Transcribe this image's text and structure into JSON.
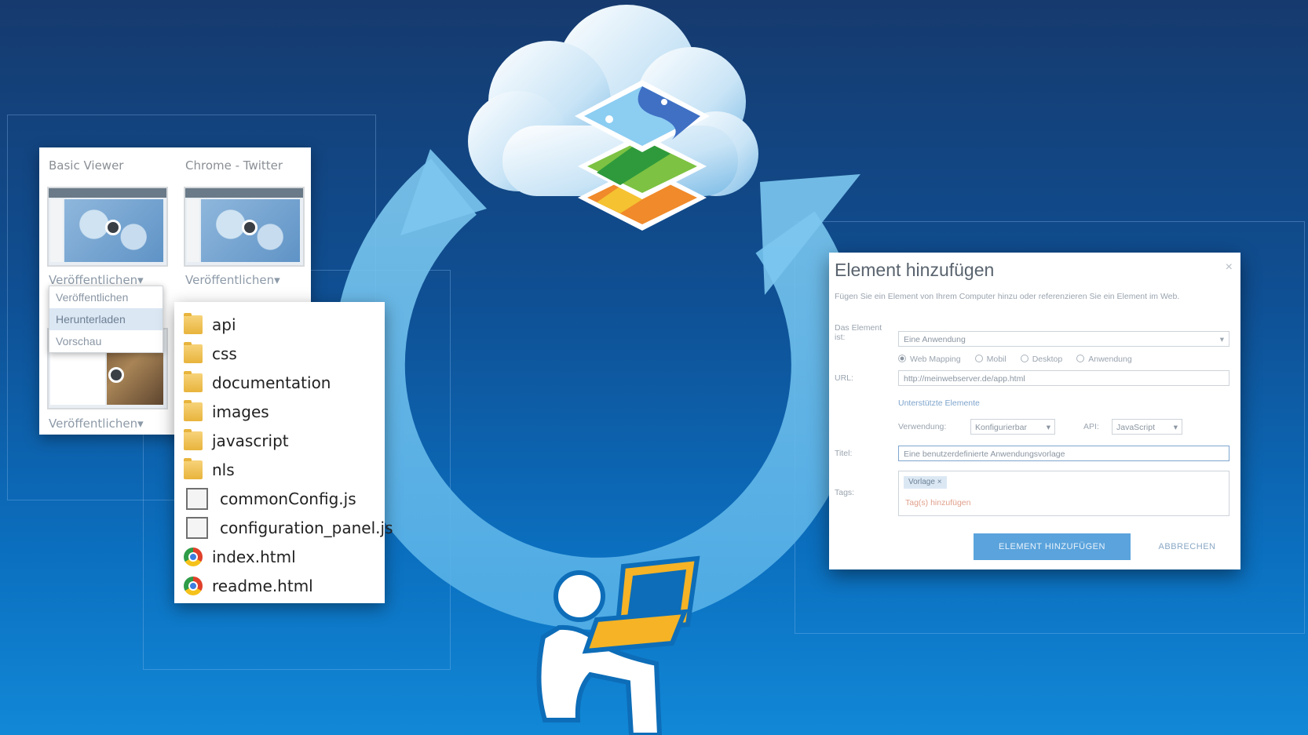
{
  "colors": {
    "background_top": "#163a6e",
    "background_bottom": "#1188d6",
    "cycle_arrow": "#6fc1ee",
    "primary_button": "#5aa3dc"
  },
  "cloud": {
    "icon": "cloud-icon",
    "layers_icon": "map-layers-icon"
  },
  "user": {
    "icon": "user-with-laptop-icon"
  },
  "gallery": {
    "items": [
      {
        "title": "Basic Viewer",
        "publish_label": "Veröffentlichen▾"
      },
      {
        "title": "Chrome - Twitter",
        "publish_label": "Veröffentlichen▾"
      },
      {
        "title": "",
        "publish_label": "Veröffentlichen▾"
      }
    ],
    "dropdown": [
      "Veröffentlichen",
      "Herunterladen",
      "Vorschau"
    ]
  },
  "files": [
    {
      "name": "api",
      "type": "folder"
    },
    {
      "name": "css",
      "type": "folder"
    },
    {
      "name": "documentation",
      "type": "folder"
    },
    {
      "name": "images",
      "type": "folder"
    },
    {
      "name": "javascript",
      "type": "folder"
    },
    {
      "name": "nls",
      "type": "folder"
    },
    {
      "name": "commonConfig.js",
      "type": "js"
    },
    {
      "name": "configuration_panel.js",
      "type": "js"
    },
    {
      "name": "index.html",
      "type": "html"
    },
    {
      "name": "readme.html",
      "type": "html"
    }
  ],
  "dialog": {
    "title": "Element hinzufügen",
    "close": "×",
    "intro": "Fügen Sie ein Element von Ihrem Computer hinzu oder referenzieren Sie ein Element im Web.",
    "label_type": "Das Element ist:",
    "select_value": "Eine Anwendung",
    "radios": [
      "Web Mapping",
      "Mobil",
      "Desktop",
      "Anwendung"
    ],
    "label_url": "URL:",
    "url_value": "http://meinwebserver.de/app.html",
    "supported_link": "Unterstützte Elemente",
    "label_usage": "Verwendung:",
    "usage_value": "Konfigurierbar",
    "label_api": "API:",
    "api_value": "JavaScript",
    "label_title": "Titel:",
    "title_value": "Eine benutzerdefinierte Anwendungsvorlage",
    "label_tags": "Tags:",
    "tag_chip": "Vorlage ×",
    "tags_placeholder": "Tag(s) hinzufügen",
    "primary_button": "ELEMENT HINZUFÜGEN",
    "cancel_button": "ABBRECHEN"
  }
}
